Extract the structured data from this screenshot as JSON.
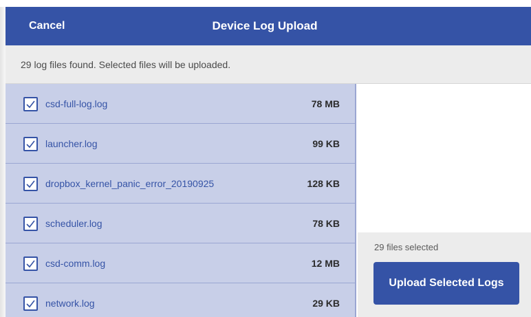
{
  "header": {
    "cancel_label": "Cancel",
    "title": "Device Log Upload"
  },
  "info": {
    "message": "29 log files found. Selected files will be uploaded."
  },
  "files": [
    {
      "name": "csd-full-log.log",
      "size": "78 MB",
      "checked": true
    },
    {
      "name": "launcher.log",
      "size": "99 KB",
      "checked": true
    },
    {
      "name": "dropbox_kernel_panic_error_20190925",
      "size": "128 KB",
      "checked": true
    },
    {
      "name": "scheduler.log",
      "size": "78 KB",
      "checked": true
    },
    {
      "name": "csd-comm.log",
      "size": "12 MB",
      "checked": true
    },
    {
      "name": "network.log",
      "size": "29 KB",
      "checked": true
    }
  ],
  "selection": {
    "count_text": "29 files selected",
    "upload_label": "Upload Selected Logs"
  },
  "colors": {
    "brand": "#3553a6",
    "list_bg": "#c8cfe8",
    "panel_bg": "#ececec"
  },
  "icons": {
    "checkbox": "checkbox-checked-icon"
  }
}
